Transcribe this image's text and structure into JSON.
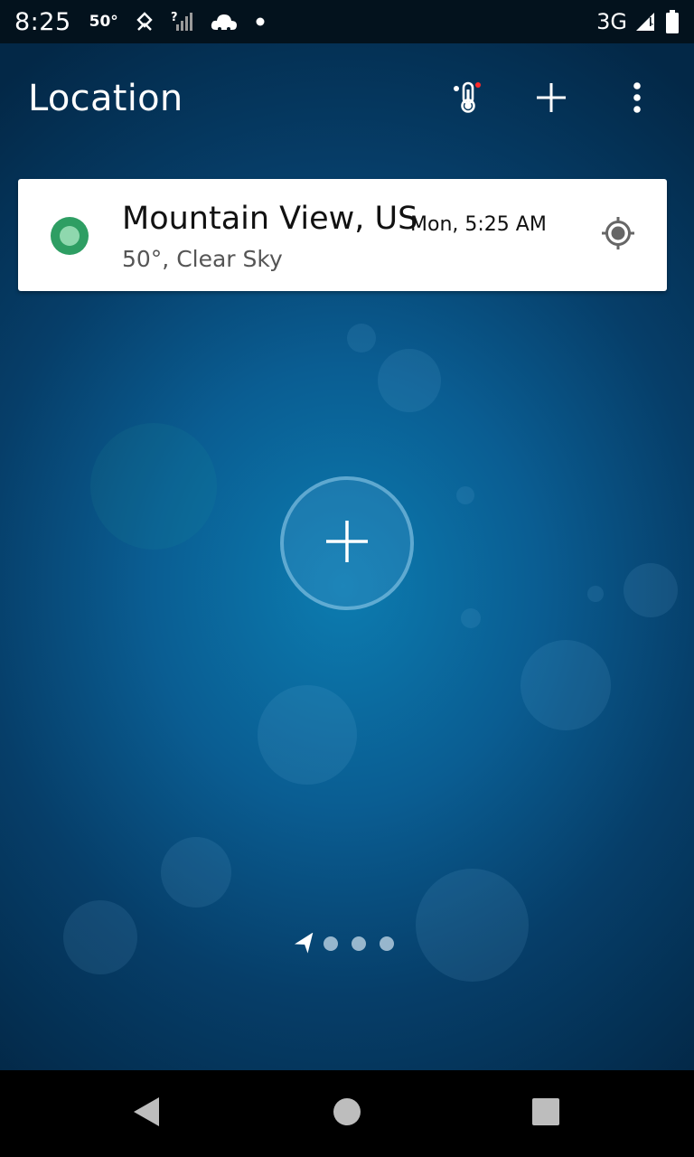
{
  "status_bar": {
    "time": "8:25",
    "temperature": "50°",
    "network": "3G",
    "icons": [
      "location-pin-icon",
      "no-signal-icon",
      "cloud-icon",
      "notification-dot-icon",
      "signal-icon",
      "battery-icon"
    ]
  },
  "toolbar": {
    "title": "Location",
    "icons": [
      "thermometer-icon",
      "plus-icon",
      "more-vert-icon"
    ],
    "thermometer_badge_color": "#ff2a2a"
  },
  "location_card": {
    "city": "Mountain View, US",
    "datetime": "Mon, 5:25 AM",
    "conditions": "50°, Clear Sky",
    "status_color": "#2e9e63",
    "action_icon": "gps-fixed-icon"
  },
  "add_location": {
    "icon": "plus-icon"
  },
  "pager": {
    "current_icon": "navigation-arrow-icon",
    "dots": 3
  },
  "nav_bar": {
    "icons": [
      "back-icon",
      "home-icon",
      "recents-icon"
    ]
  },
  "colors": {
    "status_bar_bg": "#03121d",
    "background_center": "#0c7cb0",
    "background_edge": "#032847",
    "card_bg": "#ffffff"
  }
}
